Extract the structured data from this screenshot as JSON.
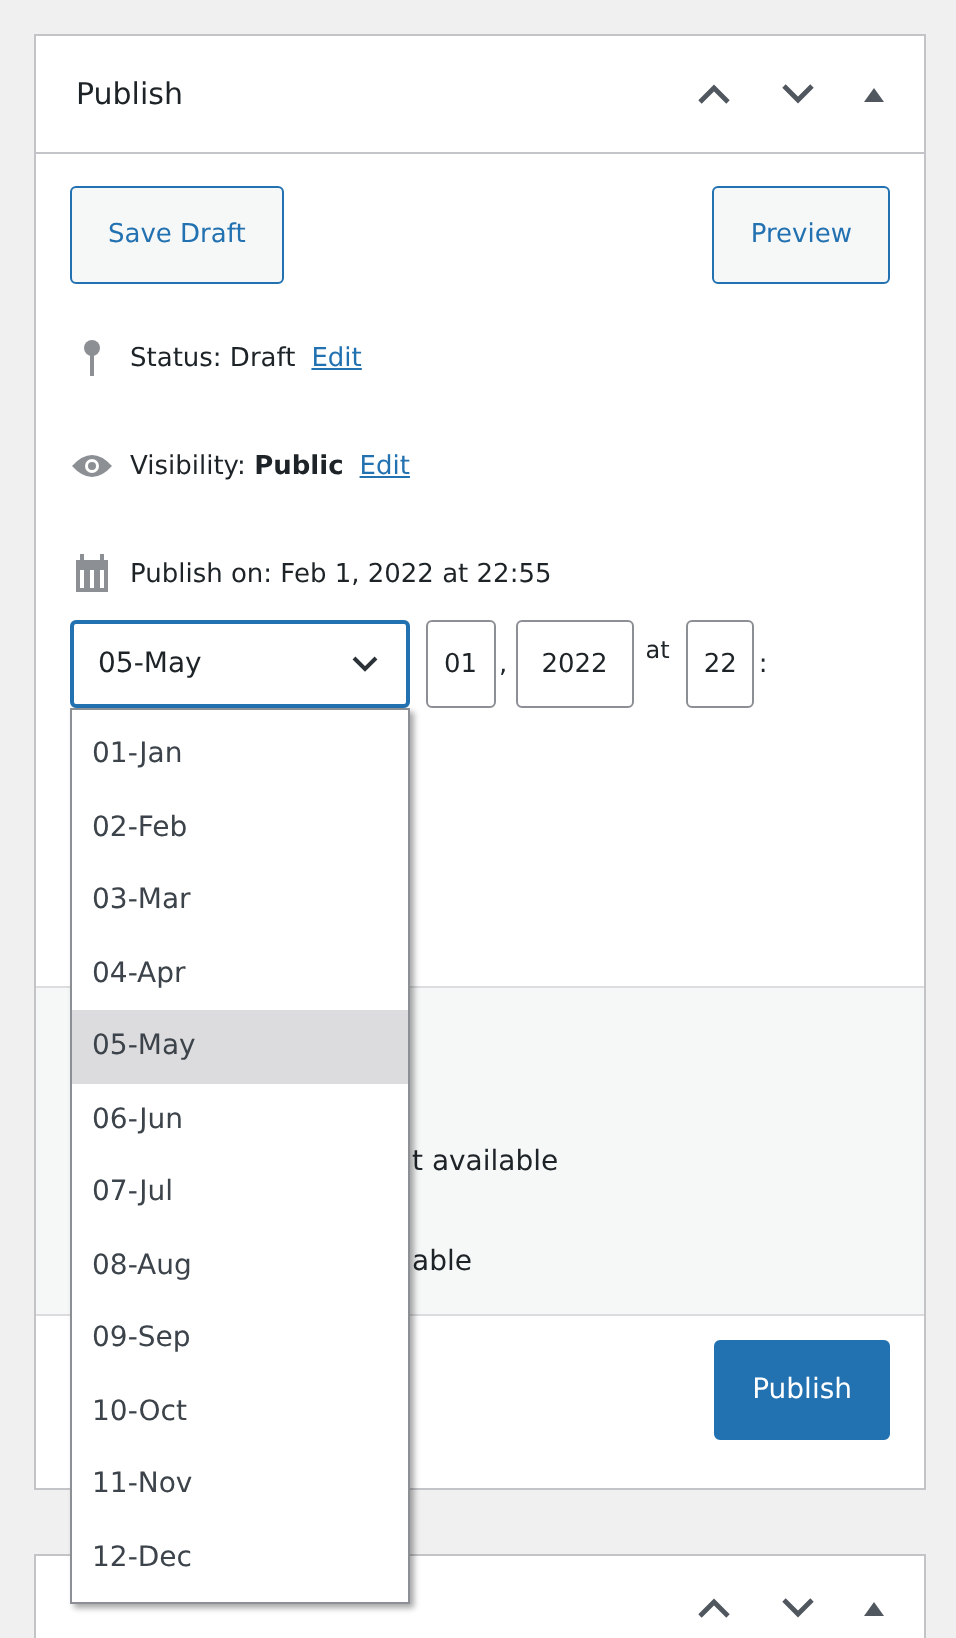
{
  "publish_box": {
    "title": "Publish",
    "save_draft": "Save Draft",
    "preview": "Preview",
    "status": {
      "label": "Status: Draft",
      "link": "Edit"
    },
    "visibility": {
      "label": "Visibility: ",
      "value": "Public",
      "link": "Edit"
    },
    "publish_on": "Publish on: Feb 1, 2022 at 22:55",
    "date": {
      "month": "05-May",
      "day": "01",
      "day_sep": ",",
      "year": "2022",
      "at": "at",
      "hour": "22",
      "hour_sep": ":"
    },
    "month_options": [
      {
        "label": "01-Jan",
        "selected": false
      },
      {
        "label": "02-Feb",
        "selected": false
      },
      {
        "label": "03-Mar",
        "selected": false
      },
      {
        "label": "04-Apr",
        "selected": false
      },
      {
        "label": "05-May",
        "selected": true
      },
      {
        "label": "06-Jun",
        "selected": false
      },
      {
        "label": "07-Jul",
        "selected": false
      },
      {
        "label": "08-Aug",
        "selected": false
      },
      {
        "label": "09-Sep",
        "selected": false
      },
      {
        "label": "10-Oct",
        "selected": false
      },
      {
        "label": "11-Nov",
        "selected": false
      },
      {
        "label": "12-Dec",
        "selected": false
      }
    ],
    "hidden_rows": [
      "t available",
      "able"
    ],
    "publish_button": "Publish"
  }
}
